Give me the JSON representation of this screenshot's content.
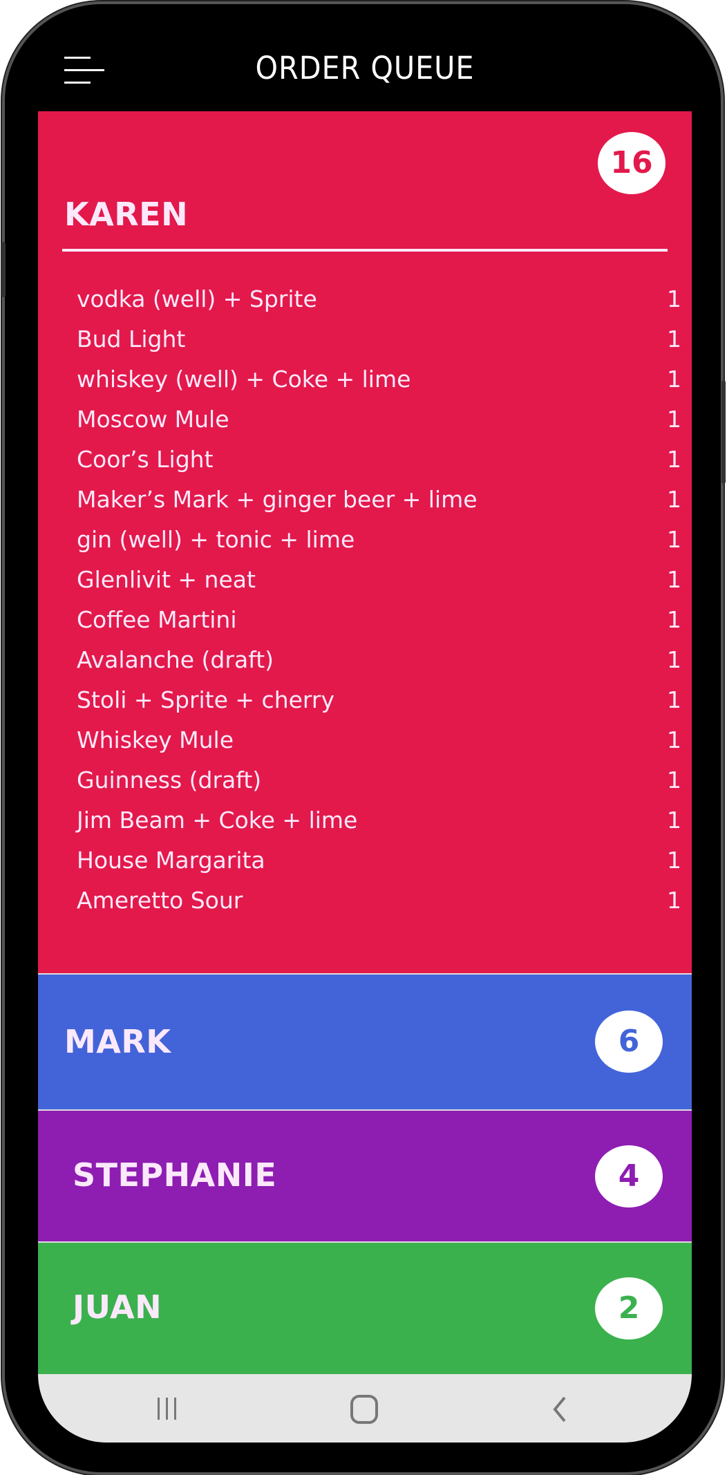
{
  "header": {
    "title": "ORDER QUEUE",
    "menu_icon": "hamburger-menu-icon"
  },
  "orders": [
    {
      "name": "KAREN",
      "count": "16",
      "color": "#e3194b",
      "expanded": true,
      "items": [
        {
          "drink": "vodka (well) + Sprite",
          "qty": "1"
        },
        {
          "drink": "Bud Light",
          "qty": "1"
        },
        {
          "drink": "whiskey (well) + Coke + lime",
          "qty": "1"
        },
        {
          "drink": "Moscow Mule",
          "qty": "1"
        },
        {
          "drink": "Coor’s Light",
          "qty": "1"
        },
        {
          "drink": "Maker’s Mark + ginger beer + lime",
          "qty": "1"
        },
        {
          "drink": "gin (well) + tonic + lime",
          "qty": "1"
        },
        {
          "drink": "Glenlivit + neat",
          "qty": "1"
        },
        {
          "drink": "Coffee Martini",
          "qty": "1"
        },
        {
          "drink": "Avalanche (draft)",
          "qty": "1"
        },
        {
          "drink": "Stoli + Sprite + cherry",
          "qty": "1"
        },
        {
          "drink": "Whiskey Mule",
          "qty": "1"
        },
        {
          "drink": "Guinness (draft)",
          "qty": "1"
        },
        {
          "drink": "Jim Beam + Coke + lime",
          "qty": "1"
        },
        {
          "drink": "House Margarita",
          "qty": "1"
        },
        {
          "drink": "Ameretto Sour",
          "qty": "1"
        }
      ]
    },
    {
      "name": "MARK",
      "count": "6",
      "color": "#4364d8",
      "expanded": false
    },
    {
      "name": "STEPHANIE",
      "count": "4",
      "color": "#8e1db2",
      "expanded": false
    },
    {
      "name": "JUAN",
      "count": "2",
      "color": "#3bb14e",
      "expanded": false
    }
  ],
  "navbar": {
    "icons": [
      "recent-apps-icon",
      "home-icon",
      "back-icon"
    ]
  }
}
